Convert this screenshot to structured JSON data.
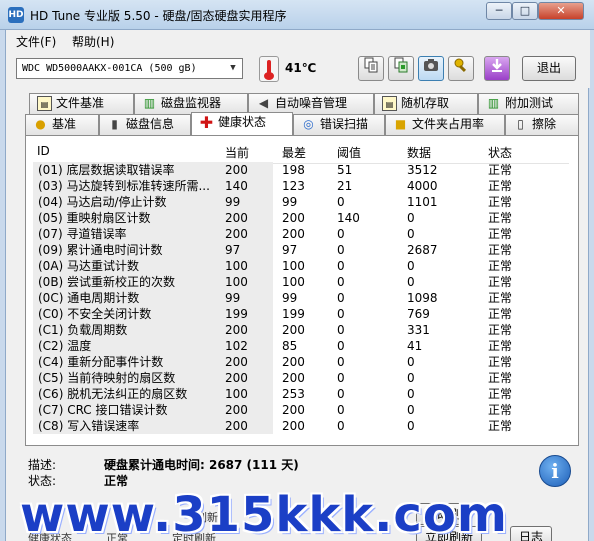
{
  "window": {
    "icon_text": "HD",
    "title": "HD Tune 专业版 5.50 - 硬盘/固态硬盘实用程序",
    "min_glyph": "─",
    "max_glyph": "□",
    "close_glyph": "✕"
  },
  "menu": {
    "file": "文件(F)",
    "help": "帮助(H)"
  },
  "toolbar": {
    "drive": "WDC WD5000AAKX-001CA (500 gB)",
    "drive_arrow": "▼",
    "temperature": "41℃",
    "exit": "退出",
    "buttons": [
      "copy-text-icon",
      "copy-screenshot-icon",
      "camera-icon",
      "tools-icon",
      "download-icon"
    ]
  },
  "tabs_row1": [
    {
      "label": "文件基准",
      "icon": "doc"
    },
    {
      "label": "磁盘监视器",
      "icon": "bar"
    },
    {
      "label": "自动噪音管理",
      "icon": "speaker"
    },
    {
      "label": "随机存取",
      "icon": "doc"
    },
    {
      "label": "附加测试",
      "icon": "bar"
    }
  ],
  "tabs_row2": [
    {
      "label": "基准",
      "icon": "bulb"
    },
    {
      "label": "磁盘信息",
      "icon": "disk"
    },
    {
      "label": "健康状态",
      "icon": "cross"
    },
    {
      "label": "错误扫描",
      "icon": "magnifier"
    },
    {
      "label": "文件夹占用率",
      "icon": "folder"
    },
    {
      "label": "擦除",
      "icon": "trash"
    }
  ],
  "table": {
    "headers": {
      "id": "ID",
      "current": "当前",
      "worst": "最差",
      "threshold": "阈值",
      "data": "数据",
      "status": "状态"
    },
    "rows": [
      {
        "id": "(01) 底层数据读取错误率",
        "current": "200",
        "worst": "198",
        "threshold": "51",
        "data": "3512",
        "status": "正常"
      },
      {
        "id": "(03) 马达旋转到标准转速所需...",
        "current": "140",
        "worst": "123",
        "threshold": "21",
        "data": "4000",
        "status": "正常"
      },
      {
        "id": "(04) 马达启动/停止计数",
        "current": "99",
        "worst": "99",
        "threshold": "0",
        "data": "1101",
        "status": "正常"
      },
      {
        "id": "(05) 重映射扇区计数",
        "current": "200",
        "worst": "200",
        "threshold": "140",
        "data": "0",
        "status": "正常"
      },
      {
        "id": "(07) 寻道错误率",
        "current": "200",
        "worst": "200",
        "threshold": "0",
        "data": "0",
        "status": "正常"
      },
      {
        "id": "(09) 累计通电时间计数",
        "current": "97",
        "worst": "97",
        "threshold": "0",
        "data": "2687",
        "status": "正常"
      },
      {
        "id": "(0A) 马达重试计数",
        "current": "100",
        "worst": "100",
        "threshold": "0",
        "data": "0",
        "status": "正常"
      },
      {
        "id": "(0B) 尝试重新校正的次数",
        "current": "100",
        "worst": "100",
        "threshold": "0",
        "data": "0",
        "status": "正常"
      },
      {
        "id": "(0C) 通电周期计数",
        "current": "99",
        "worst": "99",
        "threshold": "0",
        "data": "1098",
        "status": "正常"
      },
      {
        "id": "(C0) 不安全关闭计数",
        "current": "199",
        "worst": "199",
        "threshold": "0",
        "data": "769",
        "status": "正常"
      },
      {
        "id": "(C1) 负载周期数",
        "current": "200",
        "worst": "200",
        "threshold": "0",
        "data": "331",
        "status": "正常"
      },
      {
        "id": "(C2) 温度",
        "current": "102",
        "worst": "85",
        "threshold": "0",
        "data": "41",
        "status": "正常"
      },
      {
        "id": "(C4) 重新分配事件计数",
        "current": "200",
        "worst": "200",
        "threshold": "0",
        "data": "0",
        "status": "正常"
      },
      {
        "id": "(C5) 当前待映射的扇区数",
        "current": "200",
        "worst": "200",
        "threshold": "0",
        "data": "0",
        "status": "正常"
      },
      {
        "id": "(C6) 脱机无法纠正的扇区数",
        "current": "100",
        "worst": "253",
        "threshold": "0",
        "data": "0",
        "status": "正常"
      },
      {
        "id": "(C7) CRC 接口错误计数",
        "current": "200",
        "worst": "200",
        "threshold": "0",
        "data": "0",
        "status": "正常"
      },
      {
        "id": "(C8) 写入错误速率",
        "current": "200",
        "worst": "200",
        "threshold": "0",
        "data": "0",
        "status": "正常"
      }
    ]
  },
  "description": {
    "desc_label": "描述:",
    "desc_value": "硬盘累计通电时间: 2687 (111 天)",
    "status_label": "状态:",
    "status_value": "正常",
    "info_glyph": "i"
  },
  "bottom": {
    "health_label": "健",
    "refresh_label": "刷新",
    "refresh_now": "立即刷",
    "status_left": "健康状态",
    "status_ok": "正常",
    "time_refresh": "定时刷新",
    "refresh_now2": "立即刷新",
    "log": "日志"
  },
  "watermark": "www.315kkk.com"
}
